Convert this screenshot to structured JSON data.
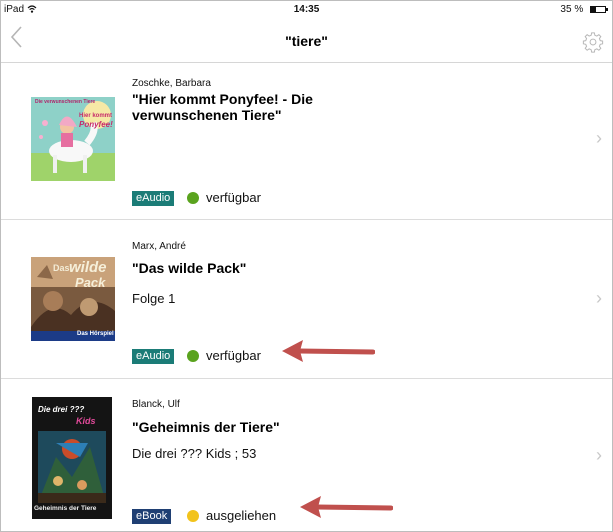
{
  "statusbar": {
    "device": "iPad",
    "time": "14:35",
    "battery_text": "35 %",
    "battery_level": 0.35
  },
  "navbar": {
    "title": "\"tiere\"",
    "back_icon": "chevron-left-icon",
    "settings_icon": "gear-icon"
  },
  "colors": {
    "eaudio_badge": "#1b7c77",
    "ebook_badge": "#1f3f73",
    "available": "#5aa31e",
    "lent": "#f2c31c",
    "arrow": "#c0504d"
  },
  "results": [
    {
      "author": "Zoschke, Barbara",
      "title": "\"Hier kommt Ponyfee! - Die verwunschenen Tiere\"",
      "subtitle": "",
      "cover_text": [
        "Die verwunschenen Tiere",
        "Hier kommt",
        "Ponyfee!"
      ],
      "media": "eAudio",
      "status": "verfügbar"
    },
    {
      "author": "Marx, André",
      "title": "\"Das wilde Pack\"",
      "subtitle": "Folge 1",
      "cover_text": [
        "Das",
        "wilde",
        "Pack",
        "Das Hörspiel"
      ],
      "media": "eAudio",
      "status": "verfügbar"
    },
    {
      "author": "Blanck, Ulf",
      "title": "\"Geheimnis der Tiere\"",
      "subtitle": "Die drei ??? Kids ; 53",
      "cover_text": [
        "Die drei ???",
        "Kids",
        "Geheimnis der Tiere"
      ],
      "media": "eBook",
      "status": "ausgeliehen"
    }
  ]
}
